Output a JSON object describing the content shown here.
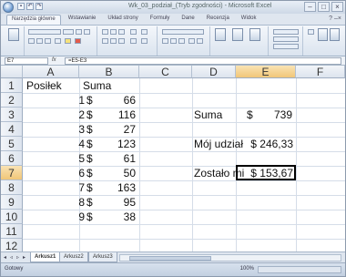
{
  "window": {
    "title": "Wk_03_podział_(Tryb zgodności) - Microsoft Excel"
  },
  "tabs": [
    "Narzędzia główne",
    "Wstawianie",
    "Układ strony",
    "Formuły",
    "Dane",
    "Recenzja",
    "Widok"
  ],
  "formula_bar": {
    "name_box": "E7",
    "fx": "fx",
    "value": "=E5-E3"
  },
  "columns": [
    "A",
    "B",
    "C",
    "D",
    "E",
    "F"
  ],
  "rows": [
    "1",
    "2",
    "3",
    "4",
    "5",
    "6",
    "7",
    "8",
    "9",
    "10",
    "11",
    "12",
    "13"
  ],
  "cells": {
    "A1": "Posiłek",
    "B1": "Suma",
    "entries": [
      {
        "n": "1",
        "cur": "$",
        "amt": "66"
      },
      {
        "n": "2",
        "cur": "$",
        "amt": "116"
      },
      {
        "n": "3",
        "cur": "$",
        "amt": "27"
      },
      {
        "n": "4",
        "cur": "$",
        "amt": "123"
      },
      {
        "n": "5",
        "cur": "$",
        "amt": "61"
      },
      {
        "n": "6",
        "cur": "$",
        "amt": "50"
      },
      {
        "n": "7",
        "cur": "$",
        "amt": "163"
      },
      {
        "n": "8",
        "cur": "$",
        "amt": "95"
      },
      {
        "n": "9",
        "cur": "$",
        "amt": "38"
      }
    ],
    "D3": "Suma",
    "E3_cur": "$",
    "E3_amt": "739",
    "D5": "Mój udział",
    "E5": "$ 246,33",
    "D7": "Zostało mi",
    "E7": "$ 153,67"
  },
  "sheet_tabs": [
    "Arkusz1",
    "Arkusz2",
    "Arkusz3"
  ],
  "status": {
    "text": "Gotowy",
    "zoom": "100%"
  }
}
